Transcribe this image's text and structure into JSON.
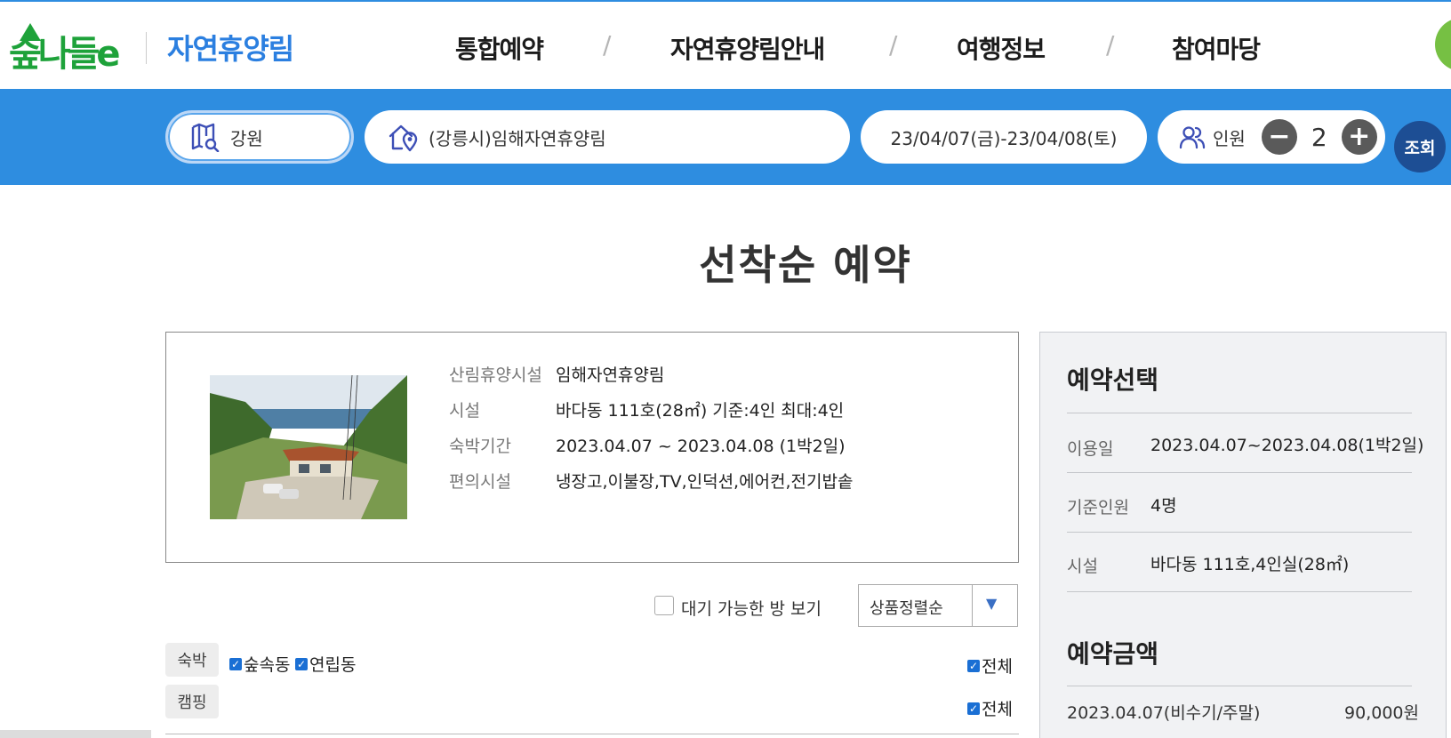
{
  "header": {
    "logo_text": "숲나들e",
    "brand": "자연휴양림",
    "nav": [
      "통합예약",
      "자연휴양림안내",
      "여행정보",
      "참여마당"
    ],
    "nav_separator": "/"
  },
  "search": {
    "region": "강원",
    "forest": "(강릉시)임해자연휴양림",
    "dates": "23/04/07(금)-23/04/08(토)",
    "people_label": "인원",
    "people_count": "2",
    "minus": "−",
    "plus": "+",
    "search_button": "조회"
  },
  "page": {
    "title": "선착순 예약"
  },
  "facility_info": {
    "rows": [
      {
        "label": "산림휴양시설",
        "value": "임해자연휴양림"
      },
      {
        "label": "시설",
        "value": "바다동 111호(28㎡) 기준:4인 최대:4인"
      },
      {
        "label": "숙박기간",
        "value": "2023.04.07 ~ 2023.04.08 (1박2일)"
      },
      {
        "label": "편의시설",
        "value": "냉장고,이불장,TV,인덕션,에어컨,전기밥솥"
      }
    ]
  },
  "filters": {
    "waiting_label": "대기 가능한 방 보기",
    "waiting_checked": false,
    "sort_selected": "상품정렬순",
    "lodging": {
      "tag": "숙박",
      "options": [
        {
          "label": "숲속동",
          "checked": true
        },
        {
          "label": "연립동",
          "checked": true
        }
      ],
      "all_label": "전체"
    },
    "camping": {
      "tag": "캠핑",
      "all_label": "전체"
    }
  },
  "side_panel": {
    "selection_title": "예약선택",
    "rows": [
      {
        "label": "이용일",
        "value": "2023.04.07~2023.04.08(1박2일)"
      },
      {
        "label": "기준인원",
        "value": "4명"
      },
      {
        "label": "시설",
        "value": "바다동 111호,4인실(28㎡)"
      }
    ],
    "amount_title": "예약금액",
    "prices": [
      {
        "label": "2023.04.07(비수기/주말)",
        "value": "90,000원"
      }
    ]
  },
  "colors": {
    "primary_blue": "#2e8de0",
    "dark_blue": "#1d4e94",
    "brand_green": "#1ea23a"
  }
}
